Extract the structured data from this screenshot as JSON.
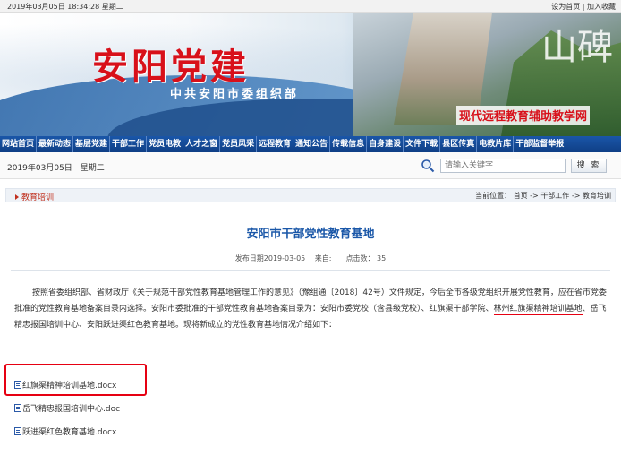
{
  "topbar": {
    "datetime": "2019年03月05日 18:34:28 星期二",
    "set_home": "设为首页",
    "separator": "|",
    "add_fav": "加入收藏"
  },
  "banner": {
    "title": "安阳党建",
    "subtitle": "中共安阳市委组织部",
    "slogan": "现代远程教育辅助教学网",
    "decor_char": "山碑"
  },
  "nav": {
    "items": [
      "网站首页",
      "最新动态",
      "基层党建",
      "干部工作",
      "党员电教",
      "人才之窗",
      "党员风采",
      "远程教育",
      "通知公告",
      "传载信息",
      "自身建设",
      "文件下载",
      "县区传真",
      "电教片库",
      "干部监督举报"
    ]
  },
  "search": {
    "date": "2019年03月05日　星期二",
    "placeholder": "请输入关键字",
    "button": "搜 索"
  },
  "breadcrumb": {
    "section": "教育培训",
    "label": "当前位置：",
    "home": "首页",
    "sep1": " -> ",
    "level1": "干部工作",
    "sep2": " -> ",
    "level2": "教育培训"
  },
  "article": {
    "title": "安阳市干部党性教育基地",
    "meta": "发布日期2019-03-05　 来自:　　点击数： 35",
    "para_part1": "按照省委组织部、省财政厅《关于规范干部党性教育基地管理工作的意见》（豫组通〔2018〕42号）文件规定，今后全市各级党组织开展党性教育，应在省市党委批准的党性教育基地备案目录内选择。安阳市委批准的干部党性教育基地备案目录为：安阳市委党校（含县级党校）、红旗渠干部学院、",
    "para_highlight": "林州红旗渠精神培训基地",
    "para_part2": "、岳飞精忠报国培训中心、安阳跃进渠红色教育基地。现将新成立的党性教育基地情况介绍如下："
  },
  "attachments": [
    {
      "name": "红旗渠精神培训基地.docx"
    },
    {
      "name": "岳飞精忠报国培训中心.doc"
    },
    {
      "name": "跃进渠红色教育基地.docx"
    }
  ],
  "colors": {
    "accent_red": "#d8101a",
    "nav_blue": "#1a56a8",
    "title_blue": "#1a57a8",
    "highlight_red": "#e60012"
  }
}
